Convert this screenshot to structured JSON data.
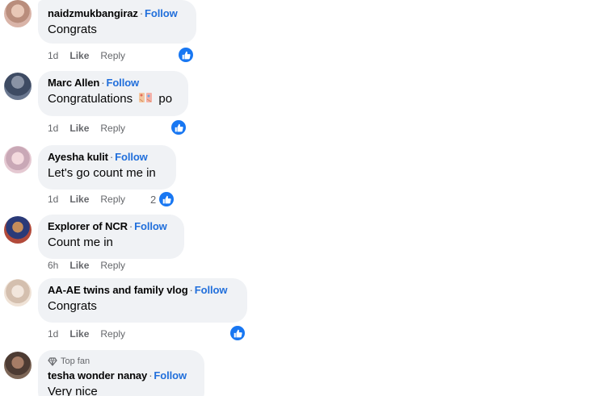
{
  "comments": [
    {
      "name": "naidzmukbangiraz",
      "follow": "Follow",
      "text": "Congrats",
      "time": "1d",
      "like": "Like",
      "reply": "Reply",
      "reaction_icon": "like-icon"
    },
    {
      "name": "Marc Allen",
      "follow": "Follow",
      "text": "Congratulations",
      "text_suffix": "po",
      "emoji_icon": "celebration-emoji-icon",
      "time": "1d",
      "like": "Like",
      "reply": "Reply",
      "reaction_icon": "like-icon"
    },
    {
      "name": "Ayesha kulit",
      "follow": "Follow",
      "text": "Let's go count me in",
      "time": "1d",
      "like": "Like",
      "reply": "Reply",
      "reaction_count": "2",
      "reaction_icon": "like-icon"
    },
    {
      "name": "Explorer of NCR",
      "follow": "Follow",
      "text": "Count me in",
      "time": "6h",
      "like": "Like",
      "reply": "Reply"
    },
    {
      "name": "AA-AE twins and family vlog",
      "follow": "Follow",
      "text": "Congrats",
      "time": "1d",
      "like": "Like",
      "reply": "Reply",
      "reaction_icon": "like-icon"
    },
    {
      "badge": "Top fan",
      "badge_icon": "diamond-icon",
      "name": "tesha wonder nanay",
      "follow": "Follow",
      "text": "Very nice"
    }
  ],
  "separator": "·",
  "colors": {
    "bubble": "#f0f2f5",
    "link": "#216fdb",
    "secondary_text": "#65676b",
    "primary_text": "#050505",
    "like_blue": "#1877f2"
  }
}
